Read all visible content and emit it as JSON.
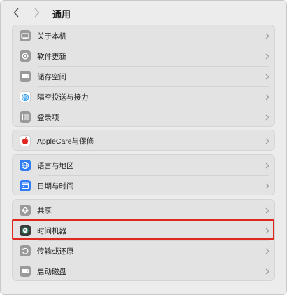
{
  "header": {
    "title": "通用",
    "back_icon": "chevron-left-icon",
    "forward_icon": "chevron-right-icon"
  },
  "groups": [
    {
      "items": [
        {
          "label": "关于本机",
          "icon": "about-this-mac-icon"
        },
        {
          "label": "软件更新",
          "icon": "software-update-icon"
        },
        {
          "label": "储存空间",
          "icon": "storage-icon"
        },
        {
          "label": "隔空投送与接力",
          "icon": "airdrop-icon"
        },
        {
          "label": "登录项",
          "icon": "login-items-icon"
        }
      ]
    },
    {
      "items": [
        {
          "label": "AppleCare与保修",
          "icon": "apple-icon"
        }
      ]
    },
    {
      "items": [
        {
          "label": "语言与地区",
          "icon": "globe-icon"
        },
        {
          "label": "日期与时间",
          "icon": "calendar-icon"
        }
      ]
    },
    {
      "items": [
        {
          "label": "共享",
          "icon": "sharing-icon"
        },
        {
          "label": "时间机器",
          "icon": "time-machine-icon",
          "highlighted": true
        },
        {
          "label": "传输或还原",
          "icon": "transfer-restore-icon"
        },
        {
          "label": "启动磁盘",
          "icon": "startup-disk-icon"
        }
      ]
    }
  ],
  "colors": {
    "highlight": "#e0281f",
    "accent_blue": "#2f7cf6"
  }
}
